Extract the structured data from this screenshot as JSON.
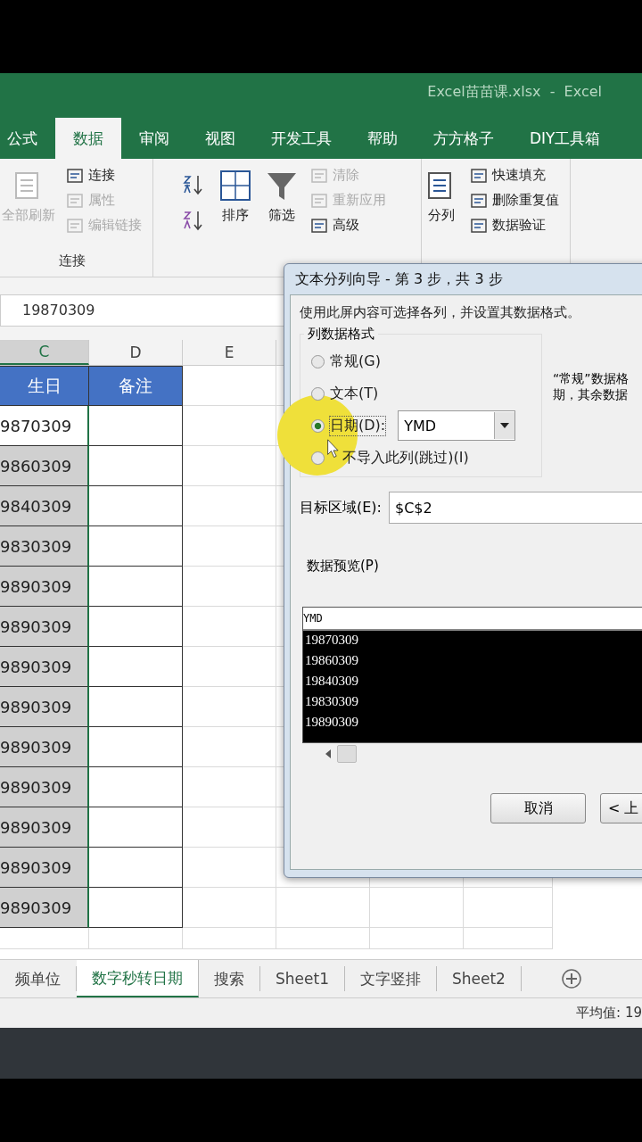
{
  "title": "Excel苗苗课.xlsx  -  Excel",
  "tabs": [
    {
      "label": "公式",
      "selected": false
    },
    {
      "label": "数据",
      "selected": true
    },
    {
      "label": "审阅",
      "selected": false
    },
    {
      "label": "视图",
      "selected": false
    },
    {
      "label": "开发工具",
      "selected": false
    },
    {
      "label": "帮助",
      "selected": false
    },
    {
      "label": "方方格子",
      "selected": false
    },
    {
      "label": "DIY工具箱",
      "selected": false
    }
  ],
  "ribbon": [
    {
      "label": "连接",
      "items": [
        {
          "kind": "big",
          "label": "全部刷新",
          "disabled": true
        },
        {
          "kind": "small",
          "label": "连接",
          "disabled": false
        },
        {
          "kind": "small",
          "label": "属性",
          "disabled": true
        },
        {
          "kind": "small",
          "label": "编辑链接",
          "disabled": true
        }
      ]
    },
    {
      "items": [
        {
          "kind": "icon"
        },
        {
          "kind": "big",
          "label": "排序",
          "disabled": false
        },
        {
          "kind": "big",
          "label": "筛选",
          "disabled": false
        },
        {
          "kind": "small",
          "label": "清除",
          "disabled": true
        },
        {
          "kind": "small",
          "label": "重新应用",
          "disabled": true
        },
        {
          "kind": "small",
          "label": "高级",
          "disabled": false
        }
      ]
    },
    {
      "items": [
        {
          "kind": "big",
          "label": "分列",
          "disabled": false
        },
        {
          "kind": "small",
          "label": "快速填充",
          "disabled": false
        },
        {
          "kind": "small",
          "label": "删除重复值",
          "disabled": false
        },
        {
          "kind": "small",
          "label": "数据验证",
          "disabled": false
        }
      ]
    }
  ],
  "formula_bar": {
    "value": "19870309"
  },
  "columns": [
    "C",
    "D",
    "E"
  ],
  "header_row": [
    "生日",
    "备注"
  ],
  "rows": [
    {
      "value": "9870309",
      "active": true
    },
    {
      "value": "9860309",
      "active": false
    },
    {
      "value": "9840309",
      "active": false
    },
    {
      "value": "9830309",
      "active": false
    },
    {
      "value": "9890309",
      "active": false
    },
    {
      "value": "9890309",
      "active": false
    },
    {
      "value": "9890309",
      "active": false
    },
    {
      "value": "9890309",
      "active": false
    },
    {
      "value": "9890309",
      "active": false
    },
    {
      "value": "9890309",
      "active": false
    },
    {
      "value": "9890309",
      "active": false
    },
    {
      "value": "9890309",
      "active": false
    },
    {
      "value": "9890309",
      "active": false
    }
  ],
  "dialog": {
    "title": "文本分列向导 - 第 3 步，共 3 步",
    "intro": "使用此屏内容可选择各列，并设置其数据格式。",
    "group_label": "列数据格式",
    "options": [
      {
        "label": "常规(G)",
        "selected": false
      },
      {
        "label": "文本(T)",
        "selected": false
      },
      {
        "label": "日期(D):",
        "selected": true
      },
      {
        "label": "不导入此列(跳过)(I)",
        "selected": false
      }
    ],
    "date_format": "YMD",
    "note": [
      "“常规”数据格",
      "期，其余数据"
    ],
    "target_label": "目标区域(E):",
    "target_value": "$C$2",
    "preview_label": "数据预览(P)",
    "preview_header": "YMD",
    "preview_rows": [
      "19870309",
      "19860309",
      "19840309",
      "19830309",
      "19890309"
    ],
    "buttons": [
      "取消",
      "< 上"
    ]
  },
  "sheet_tabs": [
    {
      "label": "频单位",
      "selected": false
    },
    {
      "label": "数字秒转日期",
      "selected": true
    },
    {
      "label": "搜索",
      "selected": false
    },
    {
      "label": "Sheet1",
      "selected": false
    },
    {
      "label": "文字竖排",
      "selected": false
    },
    {
      "label": "Sheet2",
      "selected": false
    }
  ],
  "status": "平均值: 19"
}
